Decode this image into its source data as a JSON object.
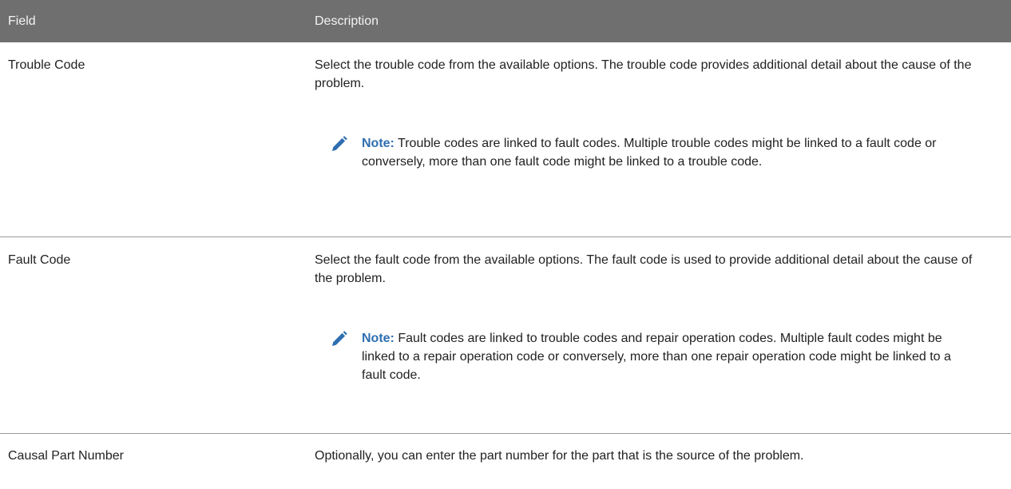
{
  "table": {
    "header": {
      "field": "Field",
      "description": "Description"
    },
    "rows": [
      {
        "field": "Trouble Code",
        "description": "Select the trouble code from the available options. The trouble code provides additional detail about the cause of the problem.",
        "note_label": "Note:",
        "note_text": "Trouble codes are linked to fault codes. Multiple trouble codes might be linked to a fault code or conversely, more than one fault code might be linked to a trouble code."
      },
      {
        "field": "Fault Code",
        "description": "Select the fault code from the available options. The fault code is used to provide additional detail about the cause of the problem.",
        "note_label": "Note:",
        "note_text": "Fault codes are linked to trouble codes and repair operation codes. Multiple fault codes might be linked to a repair operation code or conversely, more than one repair operation code might be linked to a fault code."
      },
      {
        "field": "Causal Part Number",
        "description": "Optionally, you can enter the part number for the part that is the source of the problem."
      }
    ]
  },
  "colors": {
    "header_bg": "#6f6f6f",
    "note_accent": "#2f6fb0"
  },
  "icons": {
    "note": "pencil-icon"
  }
}
